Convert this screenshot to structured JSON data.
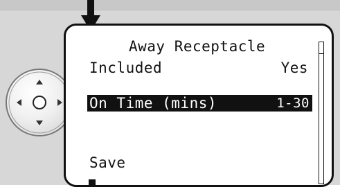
{
  "screen": {
    "title": "Away Receptacle",
    "rows": [
      {
        "label": "Included",
        "value": "Yes"
      },
      {
        "label": "On Time (mins)",
        "value": "1-30"
      }
    ],
    "save_label": "Save"
  },
  "colors": {
    "lcd_text": "#111111",
    "lcd_background": "#ffffff",
    "selection_background": "#111111",
    "panel": "#d7d7d7"
  },
  "icons": {
    "arrow": "down-arrow-icon",
    "dpad": "dpad-icon"
  }
}
